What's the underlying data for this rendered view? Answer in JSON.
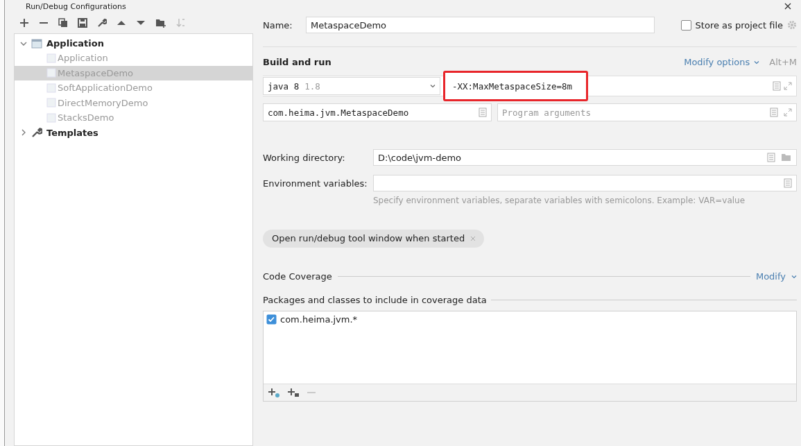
{
  "window": {
    "title": "Run/Debug Configurations"
  },
  "tree": [
    {
      "label": "Application",
      "kind": "type",
      "expanded": true,
      "children": [
        {
          "label": "Application",
          "selected": false
        },
        {
          "label": "MetaspaceDemo",
          "selected": true
        },
        {
          "label": "SoftApplicationDemo",
          "selected": false
        },
        {
          "label": "DirectMemoryDemo",
          "selected": false
        },
        {
          "label": "StacksDemo",
          "selected": false
        }
      ]
    },
    {
      "label": "Templates",
      "kind": "templates",
      "expanded": false
    }
  ],
  "name_field": {
    "label": "Name:",
    "value": "MetaspaceDemo"
  },
  "store_as_project_file": {
    "label": "Store as project file",
    "checked": false
  },
  "build_and_run": {
    "title": "Build and run",
    "modify_options": "Modify options",
    "shortcut": "Alt+M",
    "jre": {
      "value": "java 8",
      "version": "1.8"
    },
    "vm_options": {
      "value": "-XX:MaxMetaspaceSize=8m",
      "highlighted": true
    },
    "main_class": {
      "value": "com.heima.jvm.MetaspaceDemo"
    },
    "program_arguments": {
      "placeholder": "Program arguments"
    }
  },
  "working_directory": {
    "label": "Working directory:",
    "value": "D:\\code\\jvm-demo"
  },
  "environment_variables": {
    "label": "Environment variables:",
    "hint": "Specify environment variables, separate variables with semicolons. Example: VAR=value"
  },
  "option_tags": [
    {
      "label": "Open run/debug tool window when started"
    }
  ],
  "code_coverage": {
    "title": "Code Coverage",
    "modify": "Modify",
    "packages_title": "Packages and classes to include in coverage data",
    "packages": [
      {
        "label": "com.heima.jvm.*",
        "checked": true
      }
    ]
  }
}
